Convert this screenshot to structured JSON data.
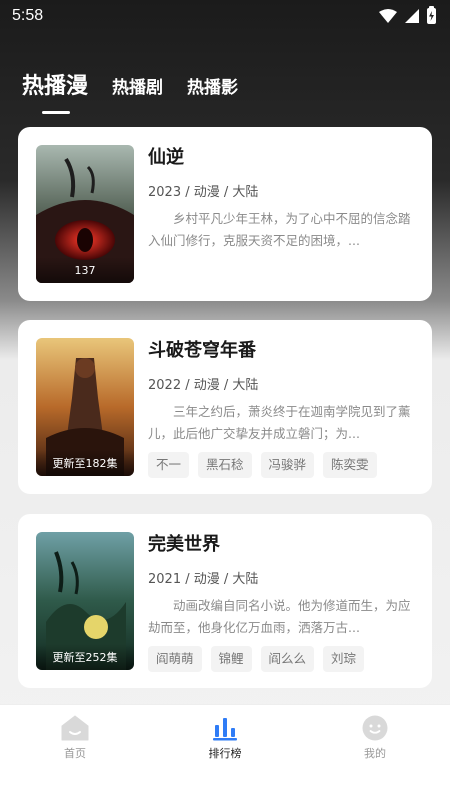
{
  "status_bar": {
    "time": "5:58"
  },
  "tabs": [
    {
      "label": "热播漫",
      "active": true
    },
    {
      "label": "热播剧",
      "active": false
    },
    {
      "label": "热播影",
      "active": false
    }
  ],
  "items": [
    {
      "title": "仙逆",
      "meta": "2023 / 动漫 / 大陆",
      "description": "乡村平凡少年王林，为了心中不屈的信念踏入仙门修行，克服天资不足的困境，...",
      "badge": "137",
      "tags": []
    },
    {
      "title": "斗破苍穹年番",
      "meta": "2022 / 动漫 / 大陆",
      "description": "三年之约后，萧炎终于在迦南学院见到了薰儿，此后他广交挚友并成立磐门；为...",
      "badge": "更新至182集",
      "tags": [
        "不一",
        "黑石稔",
        "冯骏骅",
        "陈奕雯"
      ]
    },
    {
      "title": "完美世界",
      "meta": "2021 / 动漫 / 大陆",
      "description": "动画改编自同名小说。他为修道而生，为应劫而至，他身化亿万血雨，洒落万古...",
      "badge": "更新至252集",
      "tags": [
        "阎萌萌",
        "锦鲤",
        "阎么么",
        "刘琮"
      ]
    }
  ],
  "bottom_nav": [
    {
      "label": "首页",
      "icon": "home-icon",
      "active": false
    },
    {
      "label": "排行榜",
      "icon": "rank-icon",
      "active": true
    },
    {
      "label": "我的",
      "icon": "profile-icon",
      "active": false
    }
  ],
  "colors": {
    "accent": "#2f7cf6",
    "inactive": "#d9d9d9"
  }
}
